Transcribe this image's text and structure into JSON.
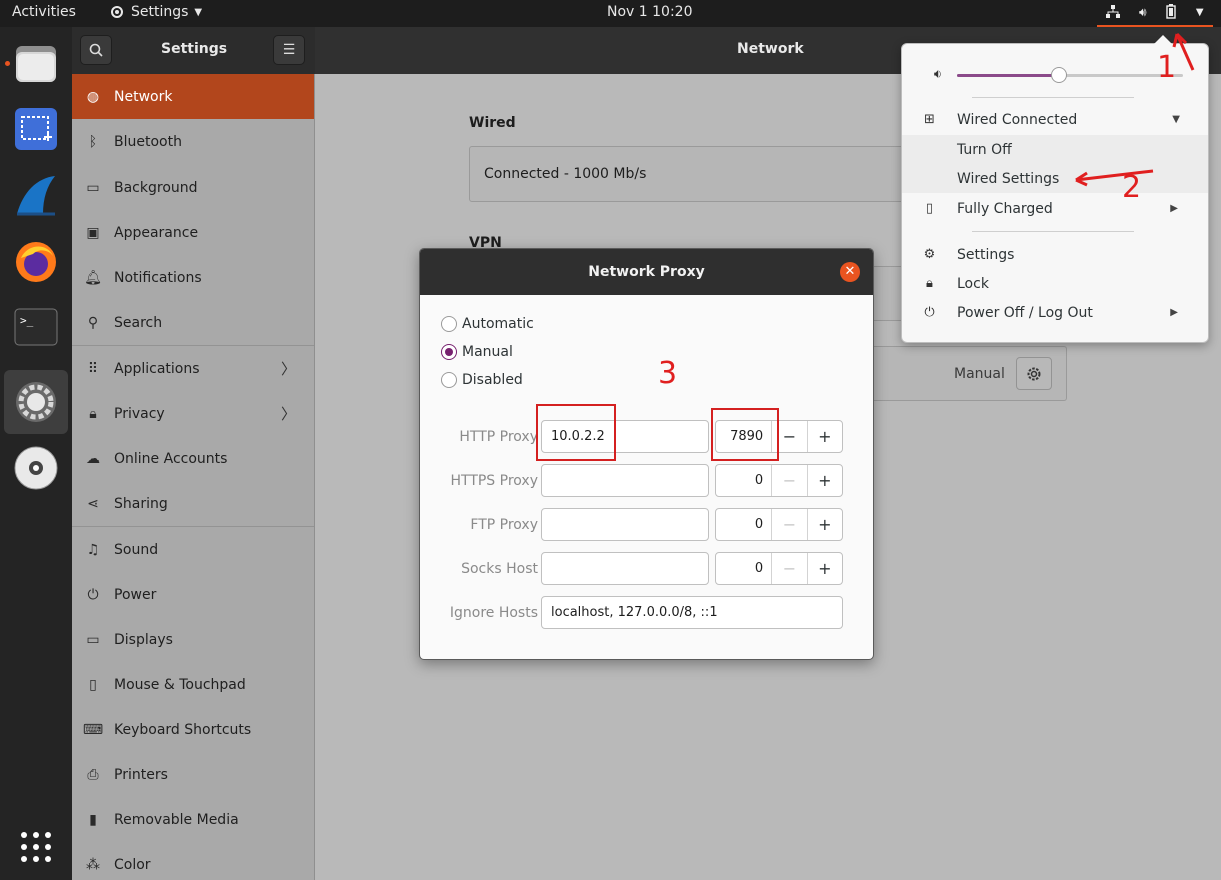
{
  "topbar": {
    "activities": "Activities",
    "app_menu": "Settings",
    "clock": "Nov 1  10:20"
  },
  "header": {
    "sidebar_title": "Settings",
    "main_title": "Network"
  },
  "sidebar": {
    "items": [
      {
        "label": "Network",
        "icon": "globe-icon"
      },
      {
        "label": "Bluetooth",
        "icon": "bluetooth-icon"
      },
      {
        "label": "Background",
        "icon": "monitor-icon"
      },
      {
        "label": "Appearance",
        "icon": "appearance-icon"
      },
      {
        "label": "Notifications",
        "icon": "bell-icon"
      },
      {
        "label": "Search",
        "icon": "search-icon"
      },
      {
        "label": "Applications",
        "icon": "grid-icon"
      },
      {
        "label": "Privacy",
        "icon": "lock-icon"
      },
      {
        "label": "Online Accounts",
        "icon": "cloud-icon"
      },
      {
        "label": "Sharing",
        "icon": "share-icon"
      },
      {
        "label": "Sound",
        "icon": "music-icon"
      },
      {
        "label": "Power",
        "icon": "power-icon"
      },
      {
        "label": "Displays",
        "icon": "display-icon"
      },
      {
        "label": "Mouse & Touchpad",
        "icon": "mouse-icon"
      },
      {
        "label": "Keyboard Shortcuts",
        "icon": "keyboard-icon"
      },
      {
        "label": "Printers",
        "icon": "printer-icon"
      },
      {
        "label": "Removable Media",
        "icon": "media-icon"
      },
      {
        "label": "Color",
        "icon": "color-icon"
      }
    ]
  },
  "network": {
    "wired_title": "Wired",
    "wired_status": "Connected - 1000 Mb/s",
    "vpn_title": "VPN",
    "proxy_mode": "Manual"
  },
  "proxy_dialog": {
    "title": "Network Proxy",
    "modes": [
      "Automatic",
      "Manual",
      "Disabled"
    ],
    "selected_mode": "Manual",
    "fields": [
      {
        "label": "HTTP Proxy",
        "host": "10.0.2.2",
        "port": "7890"
      },
      {
        "label": "HTTPS Proxy",
        "host": "",
        "port": "0"
      },
      {
        "label": "FTP Proxy",
        "host": "",
        "port": "0"
      },
      {
        "label": "Socks Host",
        "host": "",
        "port": "0"
      }
    ],
    "ignore_label": "Ignore Hosts",
    "ignore_value": "localhost, 127.0.0.0/8, ::1"
  },
  "tray_menu": {
    "volume_level": 0.45,
    "wired": "Wired Connected",
    "turn_off": "Turn Off",
    "wired_settings": "Wired Settings",
    "battery": "Fully Charged",
    "settings": "Settings",
    "lock": "Lock",
    "power": "Power Off / Log Out"
  },
  "annotations": {
    "one": "1",
    "two": "2",
    "three": "3"
  },
  "colors": {
    "accent": "#e95420",
    "selected_sidebar": "#b2461c",
    "radio": "#77216f",
    "annotation": "#e01f1f"
  }
}
